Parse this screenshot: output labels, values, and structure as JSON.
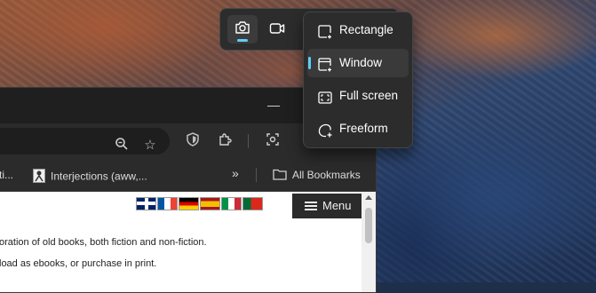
{
  "snipping_toolbar": {
    "modes": [
      {
        "icon": "camera-icon",
        "selected": true
      },
      {
        "icon": "video-camera-icon",
        "selected": false
      }
    ],
    "accent_color": "#60cdff"
  },
  "snip_mode_menu": {
    "items": [
      {
        "label": "Rectangle",
        "icon": "rectangle-snip-icon",
        "selected": false
      },
      {
        "label": "Window",
        "icon": "window-snip-icon",
        "selected": true
      },
      {
        "label": "Full screen",
        "icon": "fullscreen-snip-icon",
        "selected": false
      },
      {
        "label": "Freeform",
        "icon": "freeform-snip-icon",
        "selected": false
      }
    ]
  },
  "browser": {
    "bookmarks_bar": {
      "items": [
        {
          "label": "ti..."
        },
        {
          "label": "Interjections (aww,..."
        }
      ],
      "overflow_label": "»",
      "all_bookmarks_label": "All Bookmarks"
    },
    "page": {
      "menu_label": "Menu",
      "flags": [
        "uk-flag",
        "france-flag",
        "germany-flag",
        "spain-flag",
        "italy-flag",
        "portugal-flag"
      ],
      "lines": [
        "oration of old books, both fiction and non-fiction.",
        "load as ebooks, or purchase in print."
      ]
    }
  }
}
